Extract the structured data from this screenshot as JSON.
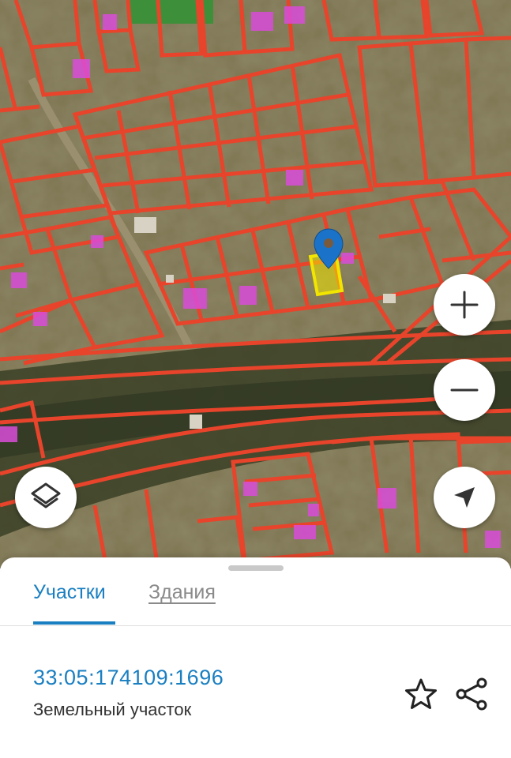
{
  "map": {
    "imagery": "satellite",
    "boundary_color": "#e8442b",
    "selected_parcel_color": "#f2e500",
    "pin_color": "#1a73c9",
    "building_highlight_color": "#d94cd9"
  },
  "controls": {
    "zoom_in_icon": "plus-icon",
    "zoom_out_icon": "minus-icon",
    "locate_icon": "navigation-arrow-icon",
    "layers_icon": "layers-icon"
  },
  "sheet": {
    "tabs": [
      {
        "label": "Участки",
        "active": true
      },
      {
        "label": "Здания",
        "active": false
      }
    ],
    "accent_color": "#1a7fc1",
    "parcel": {
      "cadastral_number": "33:05:174109:1696",
      "type": "Земельный участок"
    },
    "actions": {
      "favorite_icon": "star-icon",
      "share_icon": "share-icon"
    }
  }
}
